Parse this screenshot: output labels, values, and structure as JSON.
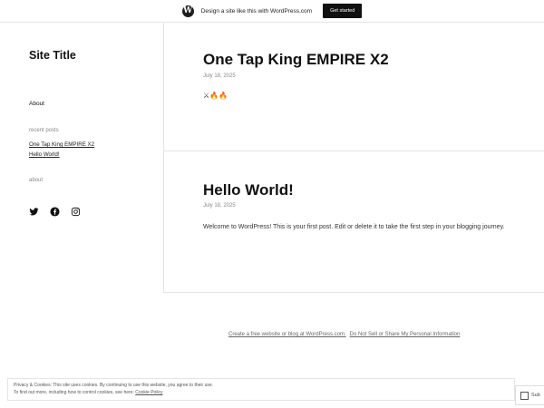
{
  "topbar": {
    "logo_glyph": "W",
    "promo_text": "Design a site like this with WordPress.com",
    "cta_label": "Get started"
  },
  "sidebar": {
    "site_title": "Site Title",
    "nav_about": "About",
    "recent_posts_label": "recent posts",
    "recent_posts": [
      "One Tap King EMPIRE X2",
      "Hello World!"
    ],
    "about_label": "about",
    "social_icons": [
      "twitter-icon",
      "facebook-icon",
      "instagram-icon"
    ]
  },
  "posts": [
    {
      "title": "One Tap King EMPIRE X2",
      "date": "July 18, 2025",
      "body": "⚔🔥🔥"
    },
    {
      "title": "Hello World!",
      "date": "July 18, 2025",
      "body": "Welcome to WordPress! This is your first post. Edit or delete it to take the first step in your blogging journey."
    }
  ],
  "footer": {
    "link1": "Create a free website or blog at WordPress.com.",
    "link2": "Do Not Sell or Share My Personal Information"
  },
  "cookie": {
    "line1": "Privacy & Cookies: This site uses cookies. By continuing to use this website, you agree to their use.",
    "line2_prefix": "To find out more, including how to control cookies, see here:",
    "line2_link": "Cookie Policy"
  },
  "follow": {
    "label": "Sub"
  }
}
